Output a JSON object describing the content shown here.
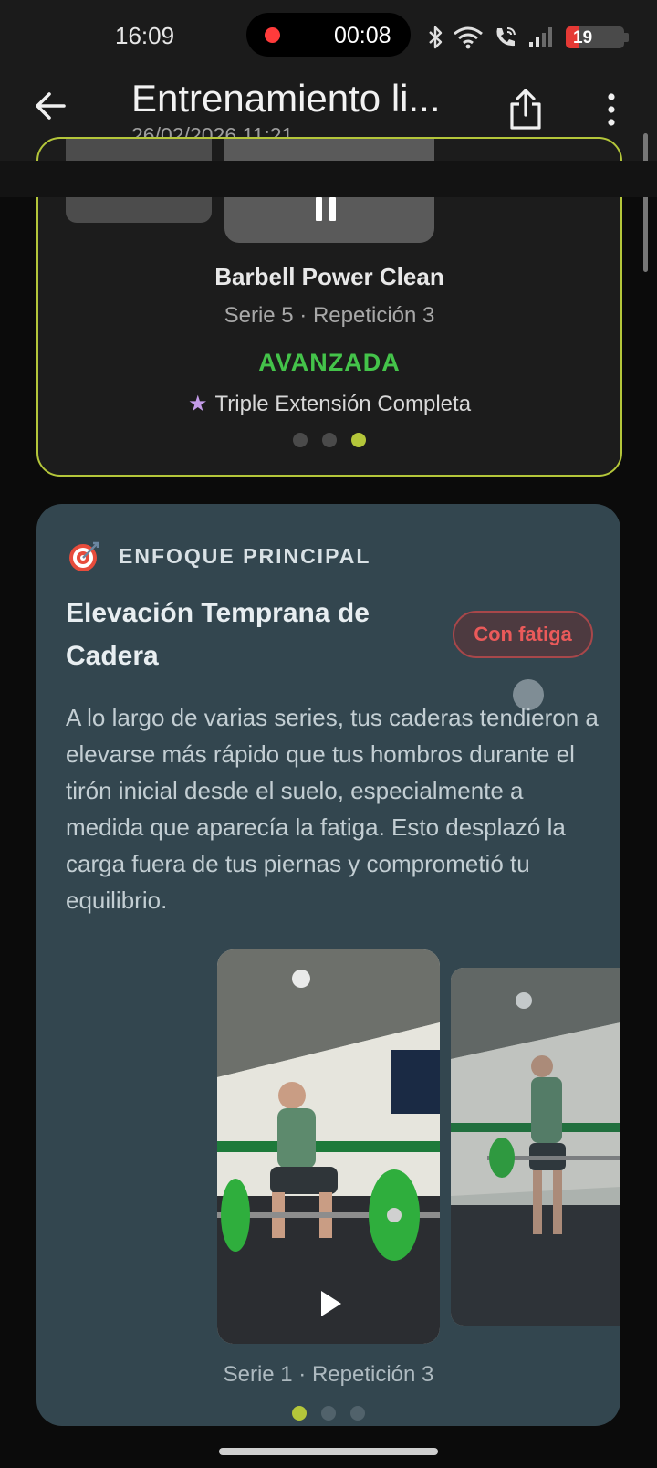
{
  "status_bar": {
    "time": "16:09",
    "recording_time": "00:08",
    "battery_level": "19",
    "icons": [
      "bluetooth-icon",
      "wifi-icon",
      "wifi-calling-icon",
      "signal-icon",
      "battery-icon"
    ]
  },
  "app_bar": {
    "title": "Entrenamiento li...",
    "subtitle": "26/02/2026 11:21",
    "icons": [
      "back-arrow-icon",
      "share-icon",
      "more-vert-icon"
    ]
  },
  "previous_card": {
    "exercise": "Barbell Power Clean",
    "meta": "Serie 5 · Repetición 3",
    "level": "AVANZADA",
    "highlight": "Triple Extensión Completa",
    "pager_total": 3,
    "pager_active": 3,
    "colors": {
      "border": "#b4c63a",
      "level": "#44c34a",
      "star": "#c39be8"
    }
  },
  "focus_card": {
    "label": "ENFOQUE PRINCIPAL",
    "title": "Elevación Temprana de Cadera",
    "badge": "Con fatiga",
    "description": "A lo largo de varias series, tus caderas tendieron a elevarse más rápido que tus hombros durante el tirón inicial desde el suelo, especialmente a medida que aparecía la fatiga. Esto desplazó la carga fuera de tus piernas y comprometió tu equilibrio.",
    "video_meta": "Serie 1 · Repetición 3",
    "pager_total": 3,
    "pager_active": 1,
    "colors": {
      "background": "#33464f",
      "badge_text": "#ea5a5a",
      "accent": "#b4c63a"
    }
  }
}
